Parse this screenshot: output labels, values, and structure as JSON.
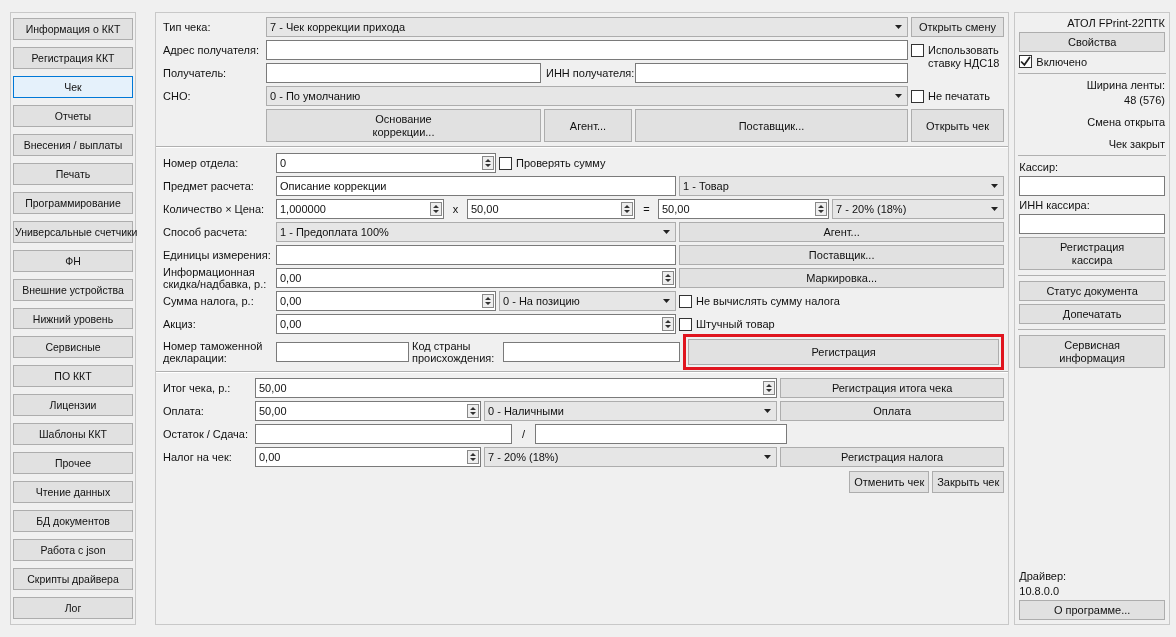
{
  "sidebar": {
    "items": [
      {
        "label": "Информация о ККТ",
        "selected": false
      },
      {
        "label": "Регистрация ККТ",
        "selected": false
      },
      {
        "label": "Чек",
        "selected": true
      },
      {
        "label": "Отчеты",
        "selected": false
      },
      {
        "label": "Внесения / выплаты",
        "selected": false
      },
      {
        "label": "Печать",
        "selected": false
      },
      {
        "label": "Программирование",
        "selected": false
      },
      {
        "label": "Универсальные счетчики",
        "selected": false
      },
      {
        "label": "ФН",
        "selected": false
      },
      {
        "label": "Внешние устройства",
        "selected": false
      },
      {
        "label": "Нижний уровень",
        "selected": false
      },
      {
        "label": "Сервисные",
        "selected": false
      },
      {
        "label": "ПО ККТ",
        "selected": false
      },
      {
        "label": "Лицензии",
        "selected": false
      },
      {
        "label": "Шаблоны ККТ",
        "selected": false
      },
      {
        "label": "Прочее",
        "selected": false
      },
      {
        "label": "Чтение данных",
        "selected": false
      },
      {
        "label": "БД документов",
        "selected": false
      },
      {
        "label": "Работа с json",
        "selected": false
      },
      {
        "label": "Скрипты драйвера",
        "selected": false
      },
      {
        "label": "Лог",
        "selected": false
      }
    ]
  },
  "header": {
    "receipt_type": {
      "label": "Тип чека:",
      "value": "7 - Чек коррекции прихода"
    },
    "open_shift_button": "Открыть смену",
    "recipient_address": {
      "label": "Адрес получателя:"
    },
    "use_vat18": {
      "label": "Использовать ставку НДС18",
      "checked": false
    },
    "recipient": {
      "label": "Получатель:"
    },
    "recipient_inn": {
      "label": "ИНН получателя:"
    },
    "tax_system": {
      "label": "СНО:",
      "value": "0 - По умолчанию"
    },
    "no_print": {
      "label": "Не печатать",
      "checked": false
    },
    "buttons": [
      "Основание коррекции...",
      "Агент...",
      "Поставщик...",
      "Открыть чек"
    ]
  },
  "position": {
    "department": {
      "label": "Номер отдела:",
      "value": "0"
    },
    "check_sum": {
      "label": "Проверять сумму",
      "checked": false
    },
    "item": {
      "label": "Предмет расчета:",
      "value": "Описание коррекции",
      "type": "1 - Товар"
    },
    "qty_price": {
      "label": "Количество × Цена:",
      "quantity": "1,000000",
      "times": "x",
      "price": "50,00",
      "equals": "=",
      "sum": "50,00",
      "vat": "7 - 20% (18%)"
    },
    "payment_method": {
      "label": "Способ расчета:",
      "value": "1 - Предоплата 100%",
      "button": "Агент..."
    },
    "units": {
      "label": "Единицы измерения:",
      "button": "Поставщик..."
    },
    "discount": {
      "label": "Информационная скидка/надбавка, р.:",
      "value": "0,00",
      "button": "Маркировка..."
    },
    "tax_sum": {
      "label": "Сумма налога, р.:",
      "value": "0,00",
      "mode": "0 - На позицию"
    },
    "no_tax_calc": {
      "label": "Не вычислять сумму налога",
      "checked": false
    },
    "excise": {
      "label": "Акциз:",
      "value": "0,00"
    },
    "piece_goods": {
      "label": "Штучный товар",
      "checked": false
    },
    "customs": {
      "label": "Номер таможенной декларации:"
    },
    "country": {
      "label": "Код страны происхождения:"
    },
    "register_button": {
      "label": "Регистрация",
      "highlighted": true
    }
  },
  "totals": {
    "total": {
      "label": "Итог чека, р.:",
      "value": "50,00",
      "button": "Регистрация итога чека"
    },
    "payment": {
      "label": "Оплата:",
      "value": "50,00",
      "type": "0 - Наличными",
      "button": "Оплата"
    },
    "change": {
      "label": "Остаток / Сдача:",
      "separator": "/"
    },
    "receipt_tax": {
      "label": "Налог на чек:",
      "value": "0,00",
      "type": "7 - 20% (18%)",
      "button": "Регистрация налога"
    },
    "buttons": [
      "Отменить чек",
      "Закрыть чек"
    ]
  },
  "device": {
    "model": "АТОЛ FPrint-22ПТК",
    "properties_button": "Свойства",
    "enabled": {
      "label": "Включено",
      "checked": true
    },
    "tape_width_label": "Ширина ленты:",
    "tape_width": "48 (576)",
    "shift_status": "Смена открыта",
    "receipt_status": "Чек закрыт",
    "cashier": {
      "label": "Кассир:"
    },
    "cashier_inn": {
      "label": "ИНН кассира:"
    },
    "register_cashier_button": "Регистрация кассира",
    "document_status_button": "Статус документа",
    "reprint_button": "Допечатать",
    "service_info_button": "Сервисная информация",
    "driver_label": "Драйвер:",
    "driver_version": "10.8.0.0",
    "about_button": "О программе..."
  }
}
